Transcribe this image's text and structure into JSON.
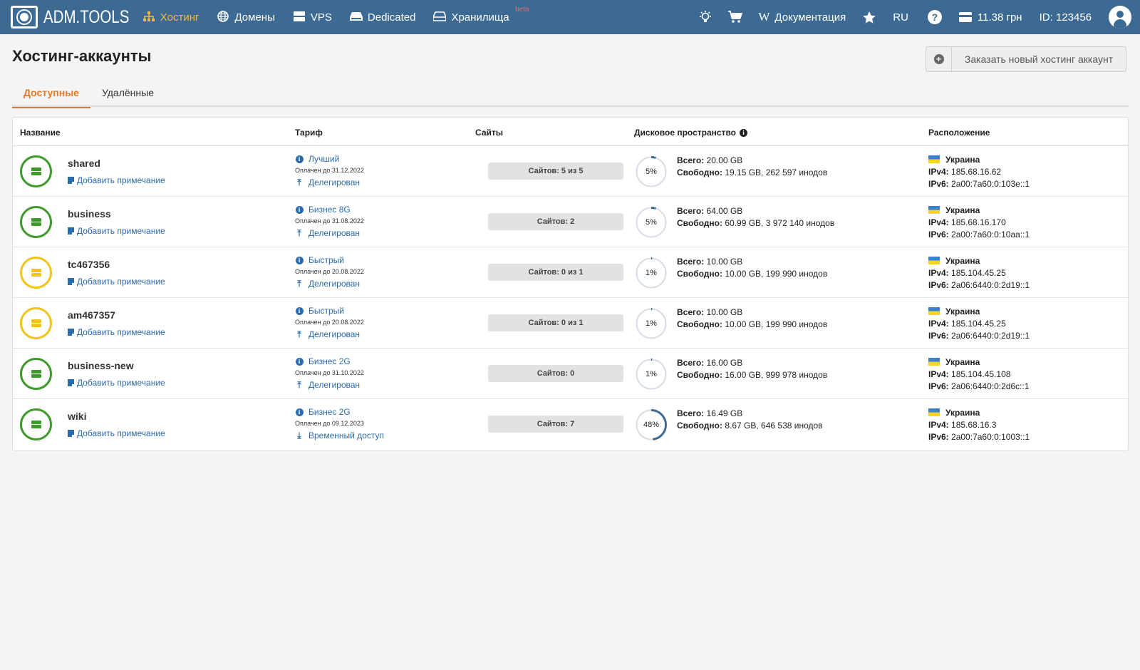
{
  "brand": {
    "logo_text": "ADM.TOOLS"
  },
  "nav": [
    {
      "label": "Хостинг",
      "icon": "sitemap-icon",
      "active": true
    },
    {
      "label": "Домены",
      "icon": "globe-icon",
      "active": false
    },
    {
      "label": "VPS",
      "icon": "server-icon",
      "active": false
    },
    {
      "label": "Dedicated",
      "icon": "hdd-icon",
      "active": false
    },
    {
      "label": "Хранилища",
      "icon": "storage-icon",
      "active": false,
      "badge": "beta"
    }
  ],
  "nav_right": {
    "docs_label": "Документация",
    "lang": "RU",
    "balance": "11.38 грн",
    "user_id": "ID: 123456"
  },
  "page": {
    "title": "Хостинг-аккаунты",
    "order_button": "Заказать новый хостинг аккаунт",
    "tabs": [
      "Доступные",
      "Удалённые"
    ]
  },
  "table": {
    "headers": {
      "name": "Название",
      "tariff": "Тариф",
      "sites": "Сайты",
      "disk": "Дисковое пространство",
      "location": "Расположение"
    },
    "labels": {
      "add_note": "Добавить примечание",
      "total": "Всего:",
      "free": "Свободно:",
      "ipv4": "IPv4:",
      "ipv6": "IPv6:"
    },
    "rows": [
      {
        "name": "shared",
        "status": "green",
        "tariff": "Лучший",
        "paid": "Оплачен до 31.12.2022",
        "access": "Делегирован",
        "access_icon": "upload-icon",
        "sites": "Сайтов: 5 из 5",
        "disk_pct": 5,
        "disk_pct_label": "5%",
        "total": "20.00 GB",
        "free": "19.15 GB, 262 597 инодов",
        "country": "Украина",
        "ipv4": "185.68.16.62",
        "ipv6": "2a00:7a60:0:103e::1"
      },
      {
        "name": "business",
        "status": "green",
        "tariff": "Бизнес 8G",
        "paid": "Оплачен до 31.08.2022",
        "access": "Делегирован",
        "access_icon": "upload-icon",
        "sites": "Сайтов: 2",
        "disk_pct": 5,
        "disk_pct_label": "5%",
        "total": "64.00 GB",
        "free": "60.99 GB, 3 972 140 инодов",
        "country": "Украина",
        "ipv4": "185.68.16.170",
        "ipv6": "2a00:7a60:0:10aa::1"
      },
      {
        "name": "tc467356",
        "status": "yellow",
        "tariff": "Быстрый",
        "paid": "Оплачен до 20.08.2022",
        "access": "Делегирован",
        "access_icon": "upload-icon",
        "sites": "Сайтов: 0 из 1",
        "disk_pct": 1,
        "disk_pct_label": "1%",
        "total": "10.00 GB",
        "free": "10.00 GB, 199 990 инодов",
        "country": "Украина",
        "ipv4": "185.104.45.25",
        "ipv6": "2a06:6440:0:2d19::1"
      },
      {
        "name": "am467357",
        "status": "yellow",
        "tariff": "Быстрый",
        "paid": "Оплачен до 20.08.2022",
        "access": "Делегирован",
        "access_icon": "upload-icon",
        "sites": "Сайтов: 0 из 1",
        "disk_pct": 1,
        "disk_pct_label": "1%",
        "total": "10.00 GB",
        "free": "10.00 GB, 199 990 инодов",
        "country": "Украина",
        "ipv4": "185.104.45.25",
        "ipv6": "2a06:6440:0:2d19::1"
      },
      {
        "name": "business-new",
        "status": "green",
        "tariff": "Бизнес 2G",
        "paid": "Оплачен до 31.10.2022",
        "access": "Делегирован",
        "access_icon": "upload-icon",
        "sites": "Сайтов: 0",
        "disk_pct": 1,
        "disk_pct_label": "1%",
        "total": "16.00 GB",
        "free": "16.00 GB, 999 978 инодов",
        "country": "Украина",
        "ipv4": "185.104.45.108",
        "ipv6": "2a06:6440:0:2d6c::1"
      },
      {
        "name": "wiki",
        "status": "green",
        "tariff": "Бизнес 2G",
        "paid": "Оплачен до 09.12.2023",
        "access": "Временный доступ",
        "access_icon": "download-icon",
        "sites": "Сайтов: 7",
        "disk_pct": 48,
        "disk_pct_label": "48%",
        "total": "16.49 GB",
        "free": "8.67 GB, 646 538 инодов",
        "country": "Украина",
        "ipv4": "185.68.16.3",
        "ipv6": "2a00:7a60:0:1003::1"
      }
    ]
  },
  "colors": {
    "topbar": "#3d6a93",
    "active_nav": "#f2b84b",
    "active_tab": "#e0792c",
    "link": "#2a6bb0",
    "status_green": "#3e9a2a",
    "status_yellow": "#f2c41a",
    "ring_fill": "#3d6a93",
    "ring_track": "#d6dde5"
  }
}
